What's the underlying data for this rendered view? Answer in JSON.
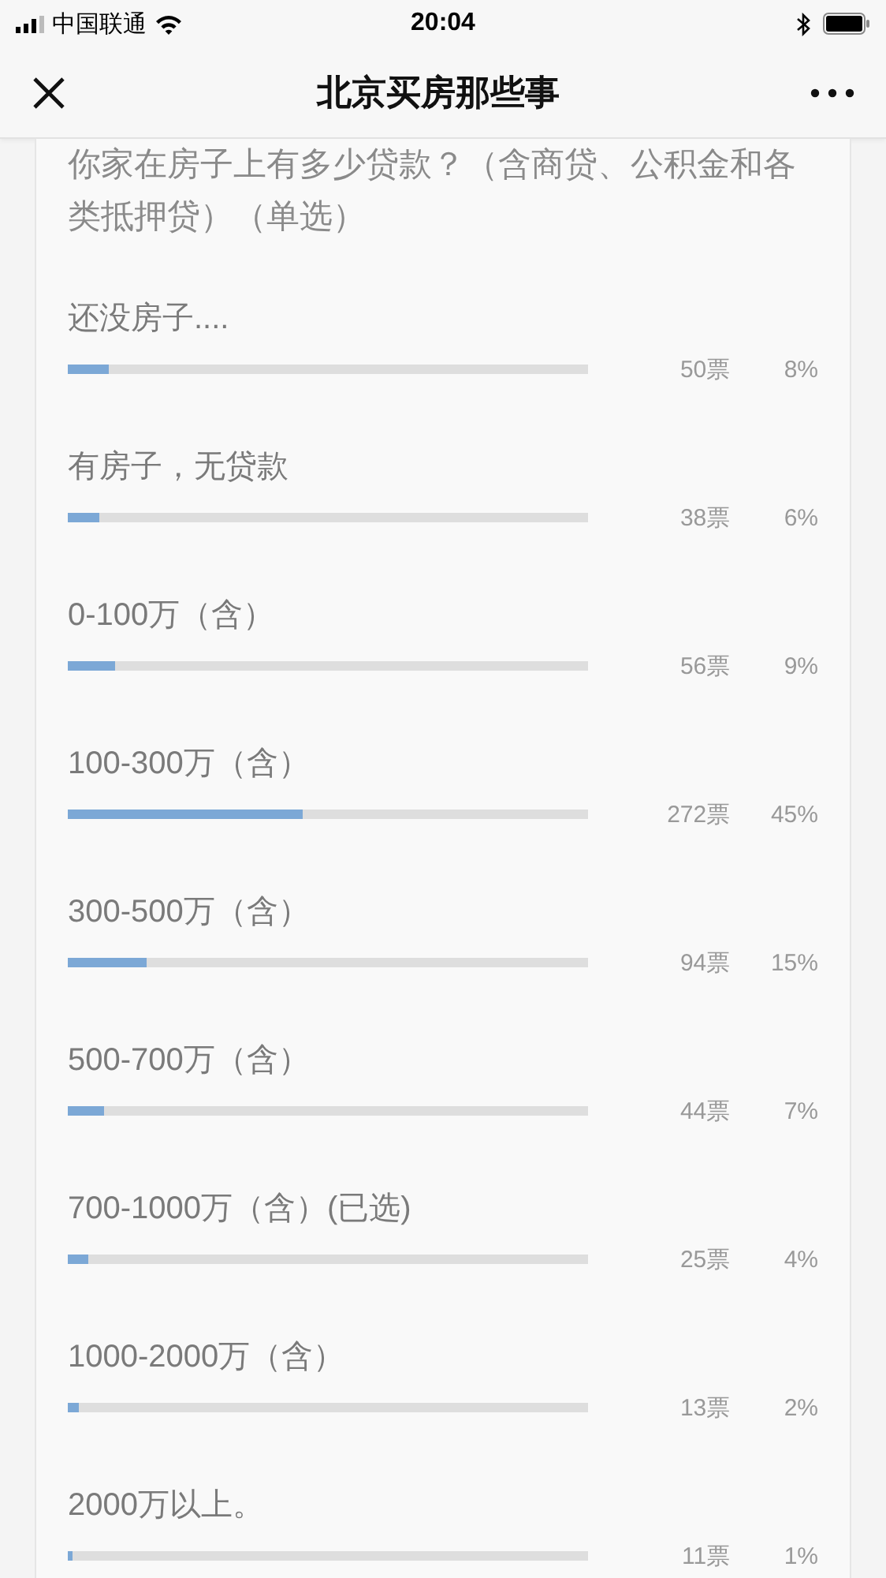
{
  "status_bar": {
    "carrier": "中国联通",
    "time": "20:04"
  },
  "header": {
    "title": "北京买房那些事"
  },
  "poll": {
    "question": "你家在房子上有多少贷款？（含商贷、公积金和各类抵押贷）（单选）",
    "options": [
      {
        "label": "还没房子....",
        "votes": "50票",
        "percent": "8%",
        "level": 0.08
      },
      {
        "label": "有房子，无贷款",
        "votes": "38票",
        "percent": "6%",
        "level": 0.06
      },
      {
        "label": "0-100万（含）",
        "votes": "56票",
        "percent": "9%",
        "level": 0.09
      },
      {
        "label": "100-300万（含）",
        "votes": "272票",
        "percent": "45%",
        "level": 0.45
      },
      {
        "label": "300-500万（含）",
        "votes": "94票",
        "percent": "15%",
        "level": 0.15
      },
      {
        "label": "500-700万（含）",
        "votes": "44票",
        "percent": "7%",
        "level": 0.07
      },
      {
        "label": "700-1000万（含）(已选)",
        "votes": "25票",
        "percent": "4%",
        "level": 0.04
      },
      {
        "label": "1000-2000万（含）",
        "votes": "13票",
        "percent": "2%",
        "level": 0.02
      },
      {
        "label": "2000万以上。",
        "votes": "11票",
        "percent": "1%",
        "level": 0.01
      }
    ]
  }
}
